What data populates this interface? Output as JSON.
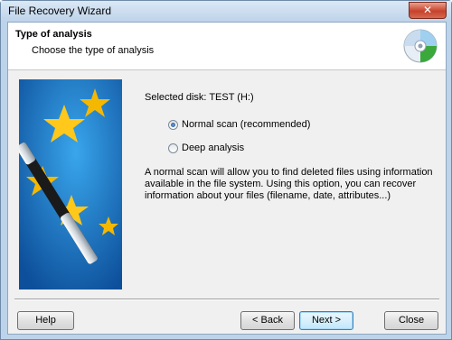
{
  "window": {
    "title": "File Recovery Wizard",
    "close_glyph": "✕"
  },
  "header": {
    "title": "Type of analysis",
    "subtitle": "Choose the type of analysis",
    "icon": "disk-icon"
  },
  "content": {
    "selected_disk": "Selected disk: TEST (H:)",
    "options": [
      {
        "label": "Normal scan (recommended)",
        "checked": true
      },
      {
        "label": "Deep analysis",
        "checked": false
      }
    ],
    "description": "A normal scan will allow you to find deleted files using information available in the file system. Using this option, you can recover information about your files (filename, date, attributes...)"
  },
  "buttons": {
    "help": "Help",
    "back": "< Back",
    "next": "Next >",
    "close": "Close"
  },
  "colors": {
    "accent_blue": "#1a6fb5",
    "star_yellow": "#f5b800",
    "disk_green": "#3aa83a"
  }
}
